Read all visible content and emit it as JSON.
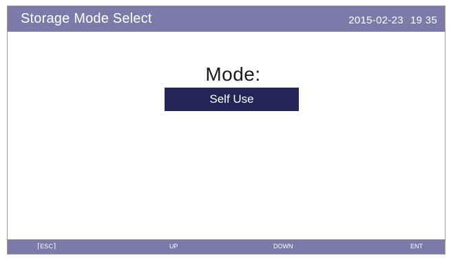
{
  "header": {
    "title": "Storage Mode Select",
    "date": "2015-02-23",
    "time": "19 35"
  },
  "main": {
    "mode_label": "Mode:",
    "selected_mode": "Self Use"
  },
  "footer": {
    "esc_label": "ESC",
    "up_label": "UP",
    "down_label": "DOWN",
    "ent_label": "ENT"
  },
  "colors": {
    "bar_background": "#7b7aa9",
    "selection_background": "#212656",
    "bar_text": "#ffffff"
  }
}
